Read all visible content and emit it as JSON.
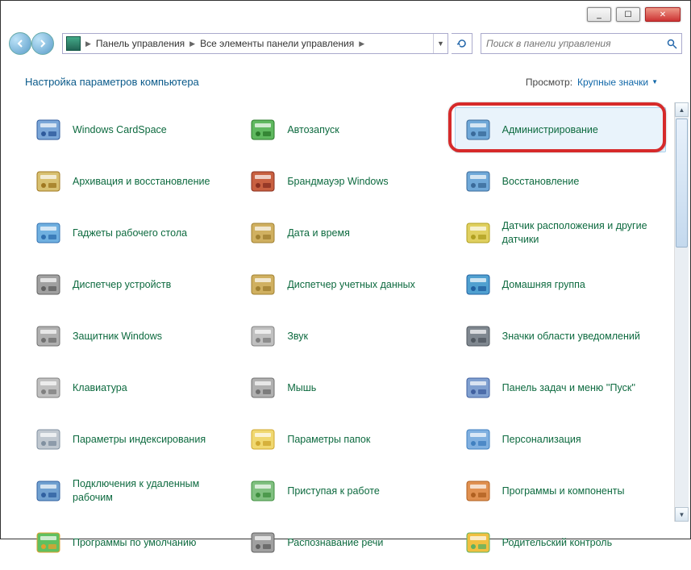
{
  "titlebar": {
    "minimize": "_",
    "maximize": "☐",
    "close": "✕"
  },
  "breadcrumb": {
    "seg1": "Панель управления",
    "seg2": "Все элементы панели управления"
  },
  "search": {
    "placeholder": "Поиск в панели управления"
  },
  "header": {
    "title": "Настройка параметров компьютера",
    "view_label": "Просмотр:",
    "view_value": "Крупные значки"
  },
  "items": [
    {
      "label": "Windows CardSpace"
    },
    {
      "label": "Автозапуск"
    },
    {
      "label": "Администрирование",
      "highlighted": true
    },
    {
      "label": "Архивация и восстановление"
    },
    {
      "label": "Брандмауэр Windows"
    },
    {
      "label": "Восстановление"
    },
    {
      "label": "Гаджеты рабочего стола"
    },
    {
      "label": "Дата и время"
    },
    {
      "label": "Датчик расположения и другие датчики"
    },
    {
      "label": "Диспетчер устройств"
    },
    {
      "label": "Диспетчер учетных данных"
    },
    {
      "label": "Домашняя группа"
    },
    {
      "label": "Защитник Windows"
    },
    {
      "label": "Звук"
    },
    {
      "label": "Значки области уведомлений"
    },
    {
      "label": "Клавиатура"
    },
    {
      "label": "Мышь"
    },
    {
      "label": "Панель задач и меню ''Пуск''"
    },
    {
      "label": "Параметры индексирования"
    },
    {
      "label": "Параметры папок"
    },
    {
      "label": "Персонализация"
    },
    {
      "label": "Подключения к удаленным рабочим"
    },
    {
      "label": "Приступая к работе"
    },
    {
      "label": "Программы и компоненты"
    },
    {
      "label": "Программы по умолчанию"
    },
    {
      "label": "Распознавание речи"
    },
    {
      "label": "Родительский контроль"
    }
  ],
  "icon_colors": [
    [
      "#7aa6d8",
      "#2e5a9c"
    ],
    [
      "#5fb85f",
      "#2a7a2a"
    ],
    [
      "#6fa8d8",
      "#3a6a9a"
    ],
    [
      "#d8c070",
      "#a07820"
    ],
    [
      "#c86040",
      "#8a3020"
    ],
    [
      "#6fa8d8",
      "#3a6a9a"
    ],
    [
      "#70b0e0",
      "#3070b0"
    ],
    [
      "#d0b060",
      "#a08030"
    ],
    [
      "#e0d060",
      "#b0a020"
    ],
    [
      "#a0a0a0",
      "#606060"
    ],
    [
      "#d0b060",
      "#a08030"
    ],
    [
      "#50a0d0",
      "#2060a0"
    ],
    [
      "#b0b0b0",
      "#707070"
    ],
    [
      "#c0c0c0",
      "#808080"
    ],
    [
      "#808890",
      "#505860"
    ],
    [
      "#c0c0c0",
      "#808080"
    ],
    [
      "#b0b0b0",
      "#707070"
    ],
    [
      "#80a0d0",
      "#4060a0"
    ],
    [
      "#c0c8d0",
      "#8090a0"
    ],
    [
      "#f0d870",
      "#d0a830"
    ],
    [
      "#80b0e0",
      "#4080c0"
    ],
    [
      "#70a0d0",
      "#3060a0"
    ],
    [
      "#80c080",
      "#409040"
    ],
    [
      "#e09050",
      "#b06020"
    ],
    [
      "#60c060",
      "#e0a030"
    ],
    [
      "#a0a0a0",
      "#606060"
    ],
    [
      "#f0c040",
      "#60b060"
    ]
  ]
}
